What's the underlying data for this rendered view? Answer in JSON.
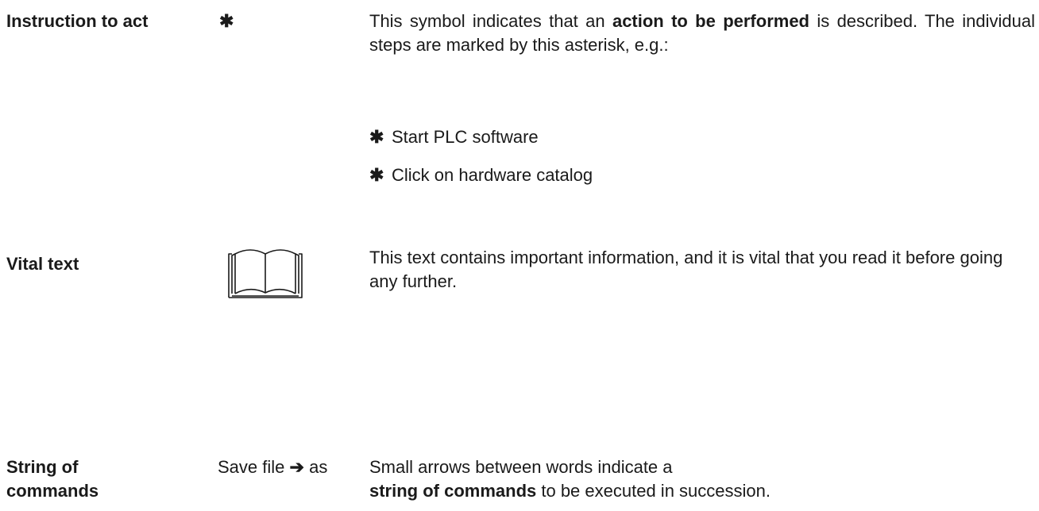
{
  "instruction": {
    "term": "Instruction to act",
    "symbol": "✱",
    "desc_pre": "This symbol indicates that an ",
    "desc_bold": "action to be performed",
    "desc_post": " is described. The individual steps are marked by this asterisk, e.g.:",
    "steps": [
      {
        "marker": "✱",
        "text": "Start PLC software"
      },
      {
        "marker": "✱",
        "text": "Click on hardware catalog"
      }
    ]
  },
  "vital": {
    "term": "Vital text",
    "icon": "open-book-icon",
    "desc": "This text contains important information, and it is vital that you read it before going any further."
  },
  "commands": {
    "term_line1": "String of",
    "term_line2": "commands",
    "example_pre": "Save file",
    "example_arrow": "➔",
    "example_post": "as",
    "desc_line1": "Small arrows between words indicate a",
    "desc_bold": "string of commands",
    "desc_post": " to be executed in succession."
  }
}
